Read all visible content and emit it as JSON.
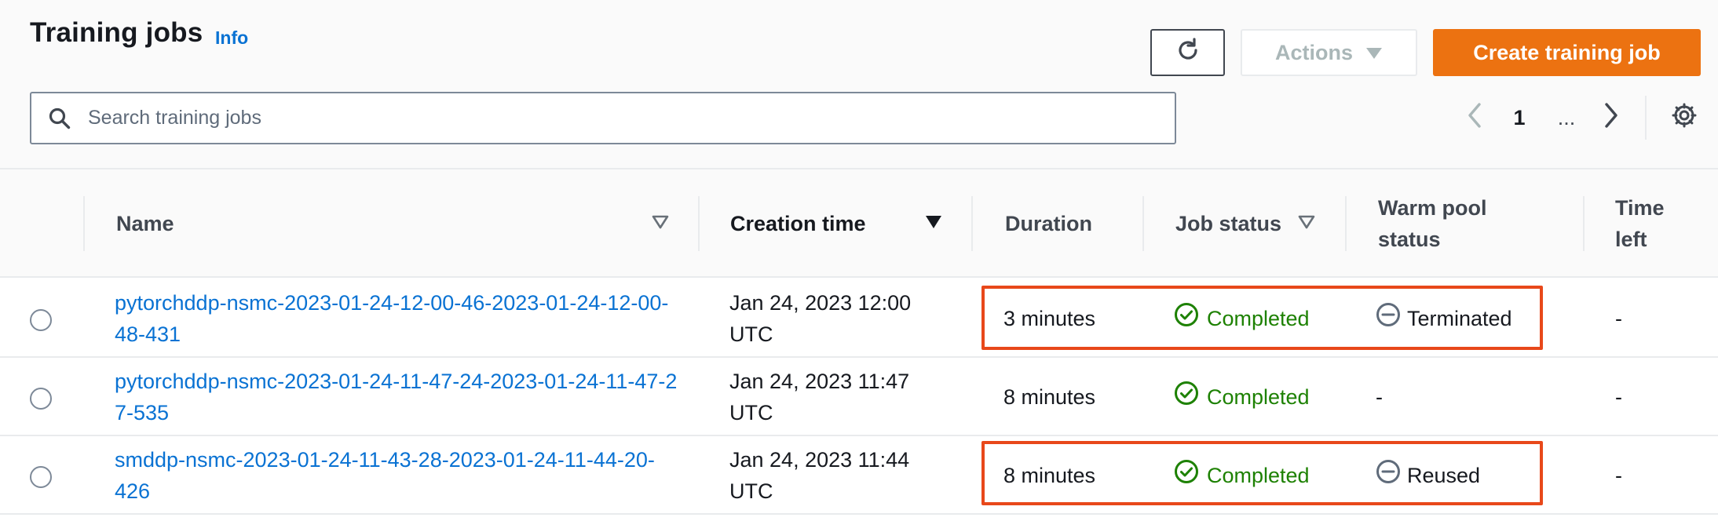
{
  "header": {
    "title": "Training jobs",
    "info": "Info"
  },
  "toolbar": {
    "refresh_icon": "refresh-icon",
    "actions_label": "Actions",
    "create_label": "Create training job"
  },
  "search": {
    "placeholder": "Search training jobs",
    "value": ""
  },
  "pagination": {
    "current_page": "1",
    "ellipsis": "..."
  },
  "table": {
    "columns": {
      "name": "Name",
      "creation_time": "Creation time",
      "duration": "Duration",
      "job_status": "Job status",
      "warm_pool_status": "Warm pool status",
      "time_left": "Time left"
    },
    "sorted_by": "creation_time",
    "rows": [
      {
        "name": "pytorchddp-nsmc-2023-01-24-12-00-46-2023-01-24-12-00-48-431",
        "creation_time": "Jan 24, 2023 12:00 UTC",
        "duration": "3 minutes",
        "job_status": "Completed",
        "warm_pool_status": "Terminated",
        "time_left": "-",
        "highlighted": true
      },
      {
        "name": "pytorchddp-nsmc-2023-01-24-11-47-24-2023-01-24-11-47-27-535",
        "creation_time": "Jan 24, 2023 11:47 UTC",
        "duration": "8 minutes",
        "job_status": "Completed",
        "warm_pool_status": "-",
        "time_left": "-",
        "highlighted": false
      },
      {
        "name": "smddp-nsmc-2023-01-24-11-43-28-2023-01-24-11-44-20-426",
        "creation_time": "Jan 24, 2023 11:44 UTC",
        "duration": "8 minutes",
        "job_status": "Completed",
        "warm_pool_status": "Reused",
        "time_left": "-",
        "highlighted": true
      }
    ]
  },
  "colors": {
    "link": "#0972d3",
    "primary_button": "#ec7211",
    "success": "#1d8102",
    "highlight_border": "#e8481a"
  }
}
